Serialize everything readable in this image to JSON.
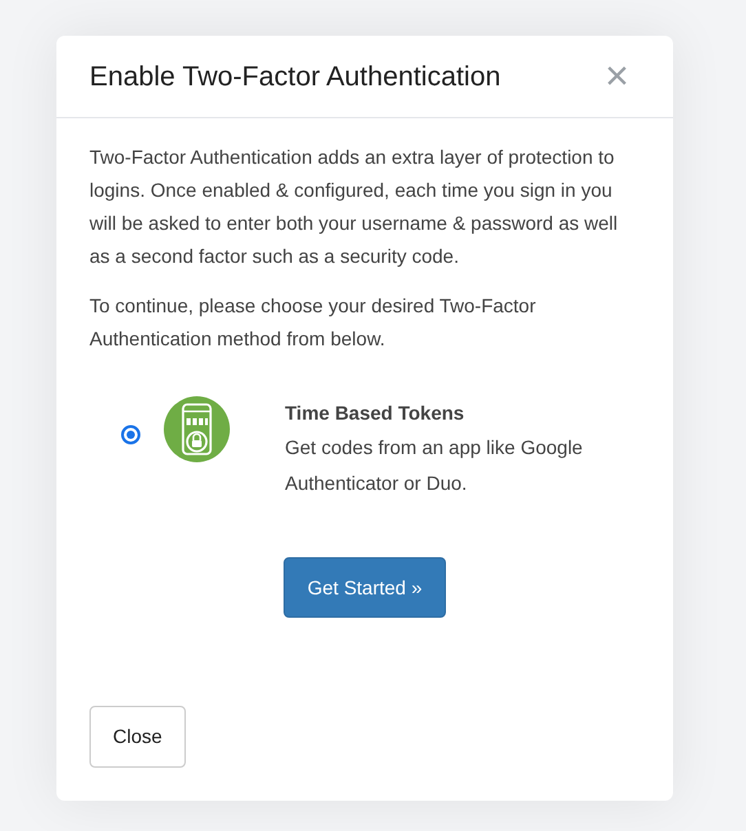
{
  "dialog": {
    "title": "Enable Two-Factor Authentication",
    "close_icon": "×",
    "paragraphs": [
      "Two-Factor Authentication adds an extra layer of protection to logins. Once enabled & configured, each time you sign in you will be asked to enter both your username & password as well as a second factor such as a security code.",
      "To continue, please choose your desired Two-Factor Authentication method from below."
    ],
    "methods": [
      {
        "title": "Time Based Tokens",
        "description": "Get codes from an app like Google Authenticator or Duo.",
        "selected": true
      }
    ],
    "primary_button": "Get Started »",
    "close_button": "Close"
  }
}
